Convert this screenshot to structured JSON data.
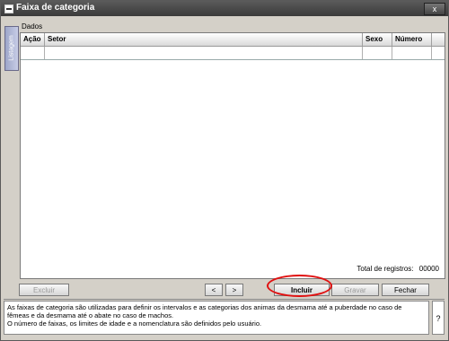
{
  "window": {
    "title": "Faixa de categoria",
    "close_label": "x"
  },
  "sidebar": {
    "tab_label": "Listagem"
  },
  "main": {
    "section_label": "Dados",
    "table": {
      "columns": [
        "Ação",
        "Setor",
        "Sexo",
        "Número"
      ],
      "rows": []
    },
    "total_label": "Total de registros:",
    "total_value": "00000"
  },
  "toolbar": {
    "excluir": "Excluir",
    "prev": "<",
    "next": ">",
    "incluir": "Incluir",
    "gravar": "Gravar",
    "fechar": "Fechar"
  },
  "info": {
    "text1": "As faixas de categoria são utilizadas para definir os intervalos e as categorias dos animas da desmama até a puberdade no caso de fêmeas e da desmama até o abate no caso de machos.",
    "text2": "O número de faixas, os limites de idade e a nomenclatura são definidos pelo usuário.",
    "help": "?"
  },
  "colors": {
    "highlight": "#e01010",
    "tab": "#9da6c9"
  }
}
